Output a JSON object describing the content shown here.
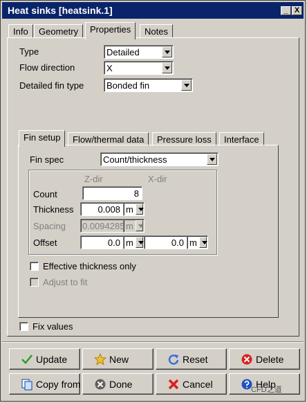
{
  "window": {
    "title": "Heat sinks [heatsink.1]",
    "minimize_glyph": "_",
    "close_glyph": "X"
  },
  "main_tabs": [
    {
      "label": "Info"
    },
    {
      "label": "Geometry"
    },
    {
      "label": "Properties",
      "active": true
    },
    {
      "label": "Notes"
    }
  ],
  "properties": {
    "type_label": "Type",
    "type_value": "Detailed",
    "flow_direction_label": "Flow direction",
    "flow_direction_value": "X",
    "fin_type_label": "Detailed fin type",
    "fin_type_value": "Bonded fin"
  },
  "sub_tabs": [
    {
      "label": "Fin setup",
      "active": true
    },
    {
      "label": "Flow/thermal data"
    },
    {
      "label": "Pressure loss"
    },
    {
      "label": "Interface"
    }
  ],
  "fin_setup": {
    "fin_spec_label": "Fin spec",
    "fin_spec_value": "Count/thickness",
    "zdir_header": "Z-dir",
    "xdir_header": "X-dir",
    "count_label": "Count",
    "count_value": "8",
    "thickness_label": "Thickness",
    "thickness_value": "0.008",
    "thickness_unit": "m",
    "spacing_label": "Spacing",
    "spacing_value": "0.0094285",
    "spacing_unit": "m",
    "offset_label": "Offset",
    "offset_z_value": "0.0",
    "offset_z_unit": "m",
    "offset_x_value": "0.0",
    "offset_x_unit": "m",
    "effective_thickness_label": "Effective thickness only",
    "adjust_to_fit_label": "Adjust to fit"
  },
  "fix_values_label": "Fix values",
  "buttons": {
    "update": "Update",
    "new": "New",
    "reset": "Reset",
    "delete": "Delete",
    "copy_from": "Copy from",
    "done": "Done",
    "cancel": "Cancel",
    "help": "Help"
  },
  "watermark": "CFD之道",
  "colors": {
    "titlebar": "#0a246a",
    "face": "#d4d0c8",
    "update_icon": "#2f9a2f",
    "new_icon": "#f0c020",
    "reset_icon": "#3a6fd8",
    "delete_icon": "#d82020",
    "cancel_icon": "#d82020",
    "help_icon": "#2050c0"
  },
  "icons": {
    "update": "check-icon",
    "new": "star-icon",
    "reset": "refresh-icon",
    "delete": "delete-icon",
    "copy_from": "copy-icon",
    "done": "done-icon",
    "cancel": "cancel-x-icon",
    "help": "help-icon"
  }
}
